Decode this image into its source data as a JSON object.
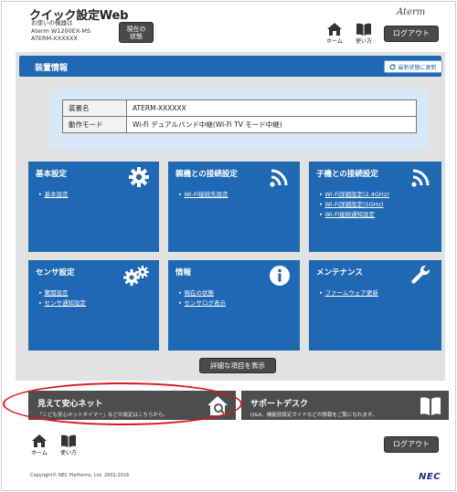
{
  "header": {
    "title": "クイック設定Web",
    "device_lines": [
      "お使いの機器は",
      "Aterm W1200EX-MS",
      "ATERM-XXXXXX"
    ],
    "current_status_lines": [
      "現在の",
      "状態"
    ],
    "logo": "Aterm",
    "home_label": "ホーム",
    "help_label": "使い方",
    "logout_label": "ログアウト"
  },
  "device_info": {
    "title": "装置情報",
    "refresh_label": "最新状態に更新",
    "rows": [
      {
        "key": "装置名",
        "value": "ATERM-XXXXXX"
      },
      {
        "key": "動作モード",
        "value": "Wi-Fi デュアルバンド中継(Wi-Fi TV モード中継)"
      }
    ]
  },
  "tiles": [
    {
      "name": "基本設定",
      "icon": "gear-icon",
      "links": [
        "基本設定"
      ]
    },
    {
      "name": "親機との接続設定",
      "icon": "wifi-icon",
      "links": [
        "Wi-Fi接続先設定"
      ]
    },
    {
      "name": "子機との接続設定",
      "icon": "wifi-icon",
      "links": [
        "Wi-Fi詳細設定(2.4GHz)",
        "Wi-Fi詳細設定(5GHz)",
        "Wi-Fi接続通知設定"
      ]
    },
    {
      "name": "センサ設定",
      "icon": "gears-icon",
      "links": [
        "驚閲設定",
        "センサ通知設定"
      ]
    },
    {
      "name": "情報",
      "icon": "info-icon",
      "links": [
        "現在の状態",
        "センサログ表示"
      ]
    },
    {
      "name": "メンテナンス",
      "icon": "wrench-icon",
      "links": [
        "ファームウェア更新"
      ]
    }
  ],
  "detail_button": "詳細な項目を表示",
  "safe_net": {
    "title": "見えて安心ネット",
    "desc": "「こども安心ネットタイマー」などの設定はこちらから。",
    "icon": "house-search-icon"
  },
  "support": {
    "title": "サポートデスク",
    "desc": "Q&A、機能別設定ガイドなどの情報をご覧になれます。",
    "icon": "book-icon"
  },
  "footer": {
    "home_label": "ホーム",
    "help_label": "使い方",
    "logout_label": "ログアウト",
    "copyright": "Copyright© NEC Platforms, Ltd. 2001-2016",
    "brand": "NEC"
  },
  "colors": {
    "accent": "#1f68b4",
    "panel": "#e2e2e2",
    "info_bg": "#d7e9f7",
    "dark": "#4d4d4d",
    "highlight": "#e0161c"
  }
}
